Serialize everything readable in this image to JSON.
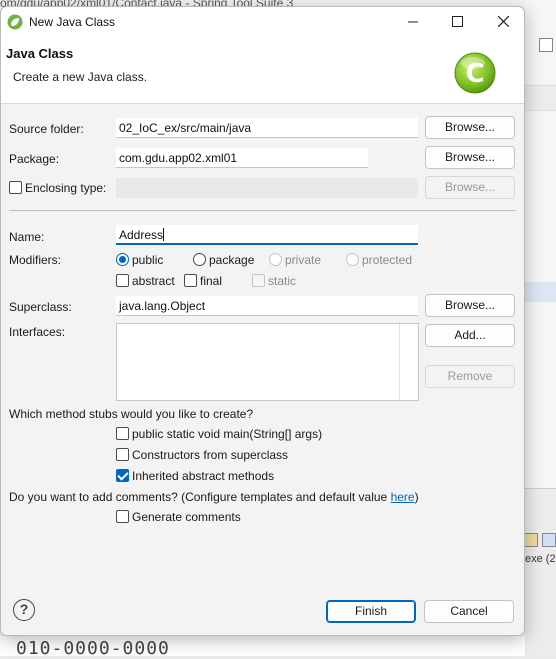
{
  "background": {
    "window_title_fragment": "om/gdu/app02/xml01/Contact.java - Spring Tool Suite 3",
    "side_label": "exe  (2",
    "bottom_text": "010-0000-0000"
  },
  "dialog": {
    "title": "New Java Class",
    "header_title": "Java Class",
    "header_subtitle": "Create a new Java class.",
    "source_folder": {
      "label": "Source folder:",
      "value": "02_IoC_ex/src/main/java",
      "browse": "Browse..."
    },
    "package": {
      "label": "Package:",
      "value": "com.gdu.app02.xml01",
      "browse": "Browse..."
    },
    "enclosing": {
      "label": "Enclosing type:",
      "value": "",
      "browse": "Browse..."
    },
    "name": {
      "label": "Name:",
      "value": "Address"
    },
    "modifiers": {
      "label": "Modifiers:",
      "access": [
        "public",
        "package",
        "private",
        "protected"
      ],
      "selected": "public",
      "flags": [
        "abstract",
        "final",
        "static"
      ]
    },
    "superclass": {
      "label": "Superclass:",
      "value": "java.lang.Object",
      "browse": "Browse..."
    },
    "interfaces": {
      "label": "Interfaces:",
      "add": "Add...",
      "remove": "Remove"
    },
    "stubs": {
      "question": "Which method stubs would you like to create?",
      "options": [
        "public static void main(String[] args)",
        "Constructors from superclass",
        "Inherited abstract methods"
      ],
      "checked": [
        false,
        false,
        true
      ]
    },
    "comments": {
      "question": "Do you want to add comments? (Configure templates and default value ",
      "link": "here",
      "question_end": ")",
      "option": "Generate comments"
    },
    "help_symbol": "?",
    "finish": "Finish",
    "cancel": "Cancel"
  },
  "colors": {
    "accent": "#0067c0",
    "icon_green": "#8cc63f"
  }
}
